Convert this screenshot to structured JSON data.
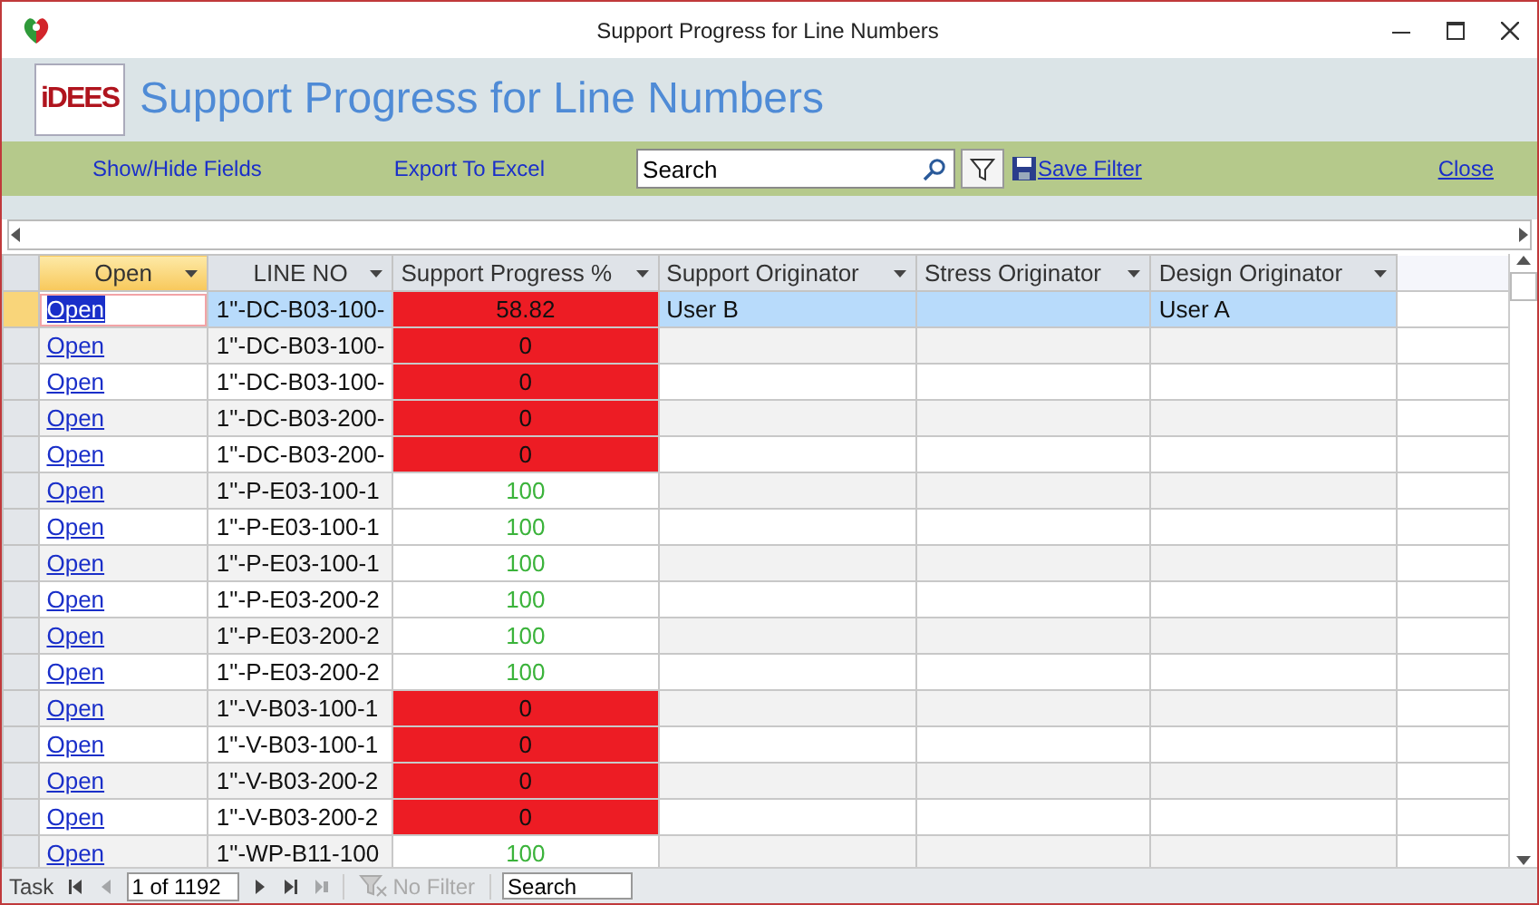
{
  "window": {
    "title": "Support Progress for Line Numbers"
  },
  "header": {
    "logo": "iDEES",
    "title": "Support Progress for Line Numbers"
  },
  "toolbar": {
    "show_hide": "Show/Hide Fields",
    "export": "Export To Excel",
    "search": {
      "value": "Search"
    },
    "save_filter": "Save Filter",
    "close": "Close"
  },
  "table": {
    "columns": [
      {
        "label": "Open",
        "selected": true
      },
      {
        "label": "LINE NO",
        "selected": false
      },
      {
        "label": "Support Progress %",
        "selected": false
      },
      {
        "label": "Support Originator",
        "selected": false
      },
      {
        "label": "Stress Originator",
        "selected": false
      },
      {
        "label": "Design Originator",
        "selected": false
      }
    ],
    "rows": [
      {
        "selected": true,
        "open": "Open",
        "line_no": "1\"-DC-B03-100-",
        "progress": "58.82",
        "kind": "behind",
        "support_originator": "User B",
        "stress_originator": "",
        "design_originator": "User A"
      },
      {
        "selected": false,
        "open": "Open",
        "line_no": "1\"-DC-B03-100-",
        "progress": "0",
        "kind": "behind"
      },
      {
        "selected": false,
        "open": "Open",
        "line_no": "1\"-DC-B03-100-",
        "progress": "0",
        "kind": "behind"
      },
      {
        "selected": false,
        "open": "Open",
        "line_no": "1\"-DC-B03-200-",
        "progress": "0",
        "kind": "behind"
      },
      {
        "selected": false,
        "open": "Open",
        "line_no": "1\"-DC-B03-200-",
        "progress": "0",
        "kind": "behind"
      },
      {
        "selected": false,
        "open": "Open",
        "line_no": "1\"-P-E03-100-1",
        "progress": "100",
        "kind": "complete"
      },
      {
        "selected": false,
        "open": "Open",
        "line_no": "1\"-P-E03-100-1",
        "progress": "100",
        "kind": "complete"
      },
      {
        "selected": false,
        "open": "Open",
        "line_no": "1\"-P-E03-100-1",
        "progress": "100",
        "kind": "complete"
      },
      {
        "selected": false,
        "open": "Open",
        "line_no": "1\"-P-E03-200-2",
        "progress": "100",
        "kind": "complete"
      },
      {
        "selected": false,
        "open": "Open",
        "line_no": "1\"-P-E03-200-2",
        "progress": "100",
        "kind": "complete"
      },
      {
        "selected": false,
        "open": "Open",
        "line_no": "1\"-P-E03-200-2",
        "progress": "100",
        "kind": "complete"
      },
      {
        "selected": false,
        "open": "Open",
        "line_no": "1\"-V-B03-100-1",
        "progress": "0",
        "kind": "behind"
      },
      {
        "selected": false,
        "open": "Open",
        "line_no": "1\"-V-B03-100-1",
        "progress": "0",
        "kind": "behind"
      },
      {
        "selected": false,
        "open": "Open",
        "line_no": "1\"-V-B03-200-2",
        "progress": "0",
        "kind": "behind"
      },
      {
        "selected": false,
        "open": "Open",
        "line_no": "1\"-V-B03-200-2",
        "progress": "0",
        "kind": "behind"
      },
      {
        "selected": false,
        "open": "Open",
        "line_no": "1\"-WP-B11-100",
        "progress": "100",
        "kind": "complete"
      }
    ]
  },
  "status_bar": {
    "label": "Task",
    "record": "1 of 1192",
    "filter": "No Filter",
    "search": {
      "value": "Search"
    }
  }
}
